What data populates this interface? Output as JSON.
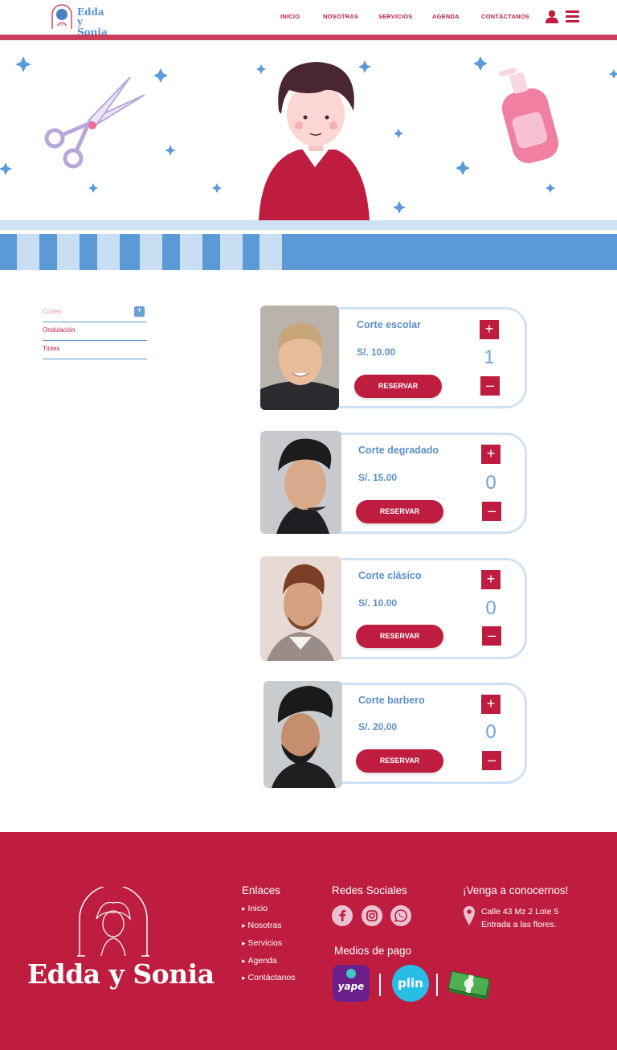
{
  "brand": {
    "logo_line1": "Edda y",
    "logo_line2": "Sonia",
    "name": "Edda y Sonia"
  },
  "nav": [
    "INICIO",
    "NOSOTRAS",
    "SERVICIOS",
    "AGENDA",
    "CONTÁCTANOS"
  ],
  "sidebar": {
    "items": [
      {
        "label": "Cortes",
        "active": true,
        "toggle": "+"
      },
      {
        "label": "Ondulación"
      },
      {
        "label": "Tintes"
      }
    ]
  },
  "products": [
    {
      "name": "Corte escolar",
      "price": "S/. 10.00",
      "qty": "1",
      "reserve": "RESERVAR",
      "plus": "+",
      "minus": "–"
    },
    {
      "name": "Corte degradado",
      "price": "S/. 15.00",
      "qty": "0",
      "reserve": "RESERVAR",
      "plus": "+",
      "minus": "–"
    },
    {
      "name": "Corte clásico",
      "price": "S/. 10.00",
      "qty": "0",
      "reserve": "RESERVAR",
      "plus": "+",
      "minus": "–"
    },
    {
      "name": "Corte barbero",
      "price": "S/. 20.00",
      "qty": "0",
      "reserve": "RESERVAR",
      "plus": "+",
      "minus": "–"
    }
  ],
  "footer": {
    "links_title": "Enlaces",
    "links": [
      "Inicio",
      "Nosotras",
      "Servicios",
      "Agenda",
      "Contáctanos"
    ],
    "social_title": "Redes Sociales",
    "social_icons": [
      "facebook-icon",
      "instagram-icon",
      "whatsapp-icon"
    ],
    "payment_title": "Medios de pago",
    "payment_methods": [
      "yape",
      "plin",
      "cash"
    ],
    "visit_title": "¡Venga a conocernos!",
    "address_line1": "Calle 43 Mz 2 Lote 5",
    "address_line2": "Entrada a las flores."
  },
  "colors": {
    "primary": "#bf1d3f",
    "accent_blue": "#5b9ad6",
    "light_blue": "#cfe2f5"
  }
}
